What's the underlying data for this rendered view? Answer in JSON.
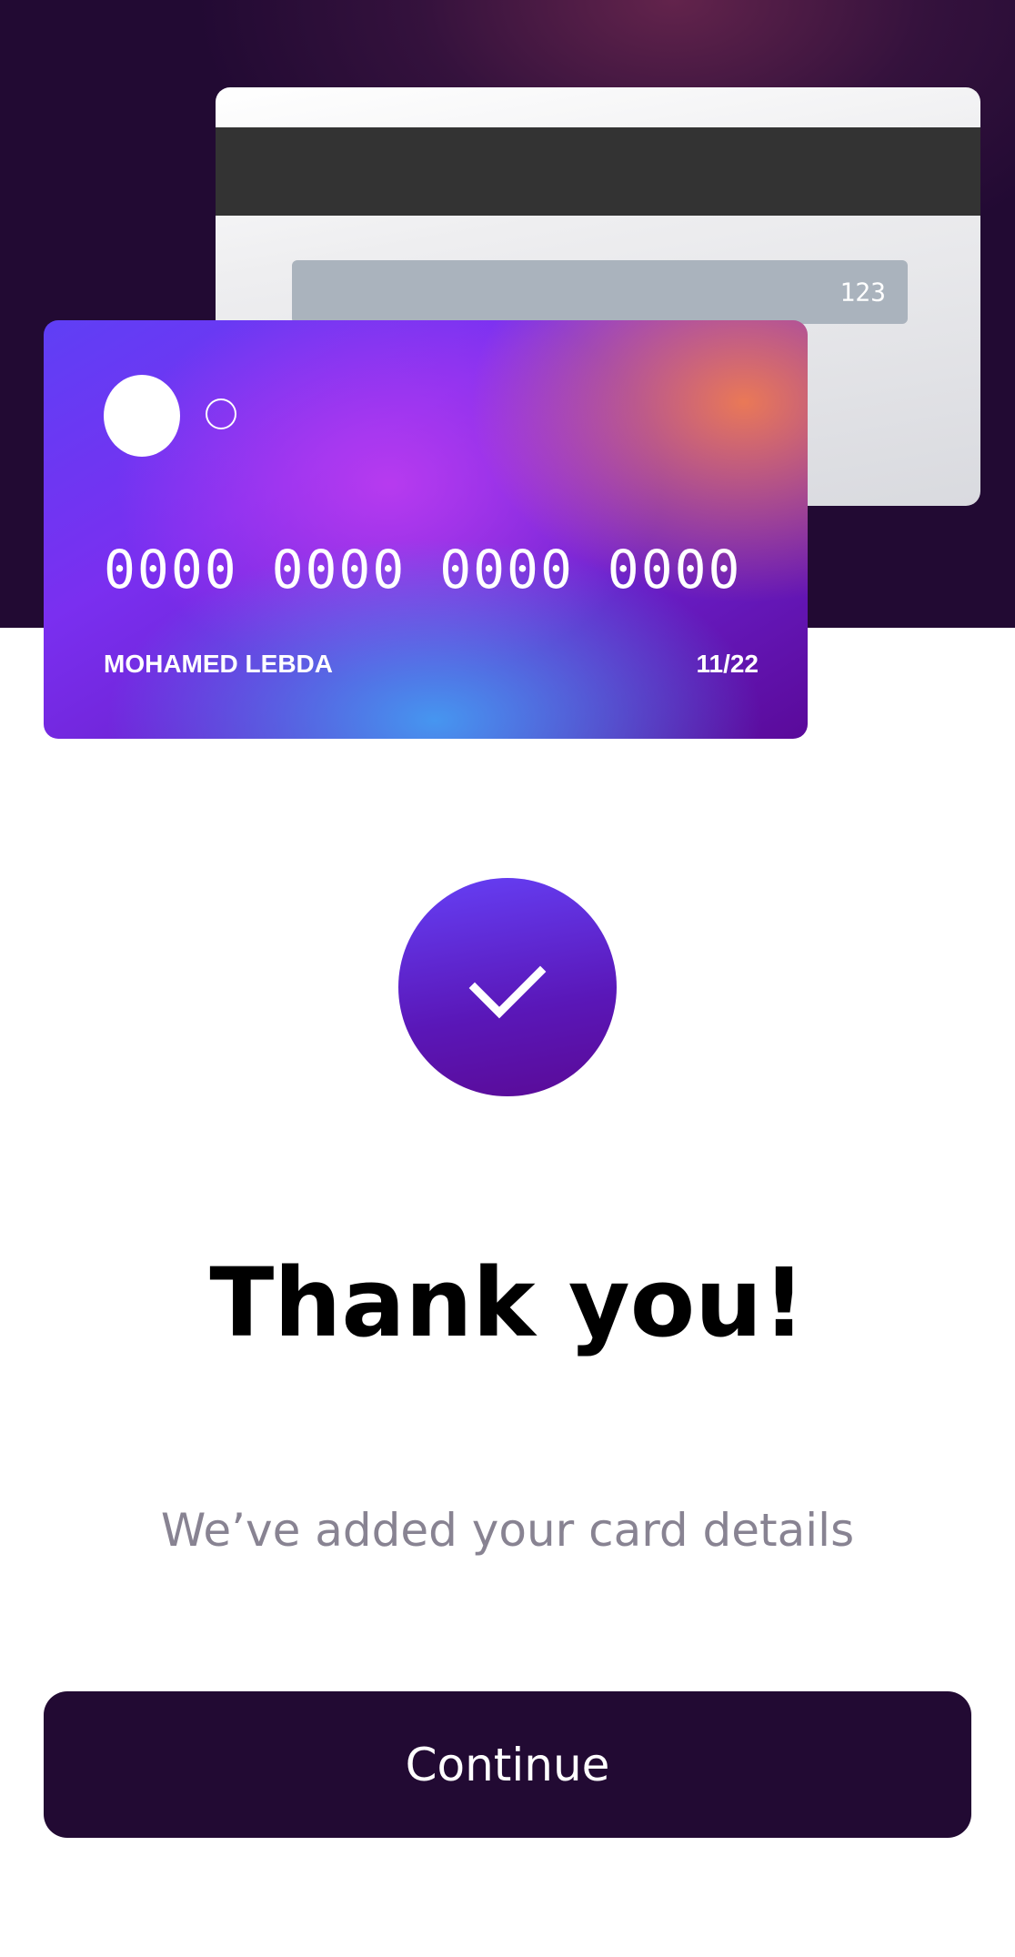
{
  "card_back": {
    "cvv": "123"
  },
  "card_front": {
    "number": "0000 0000 0000 0000",
    "holder_name": "MOHAMED LEBDA",
    "expiry": "11/22"
  },
  "success": {
    "icon": "check-icon",
    "title": "Thank you!",
    "subtitle": "We’ve added your card details"
  },
  "actions": {
    "continue_label": "Continue"
  },
  "colors": {
    "primary_dark": "#220a33",
    "accent_purple": "#6640f6",
    "subtitle_gray": "#888392"
  }
}
